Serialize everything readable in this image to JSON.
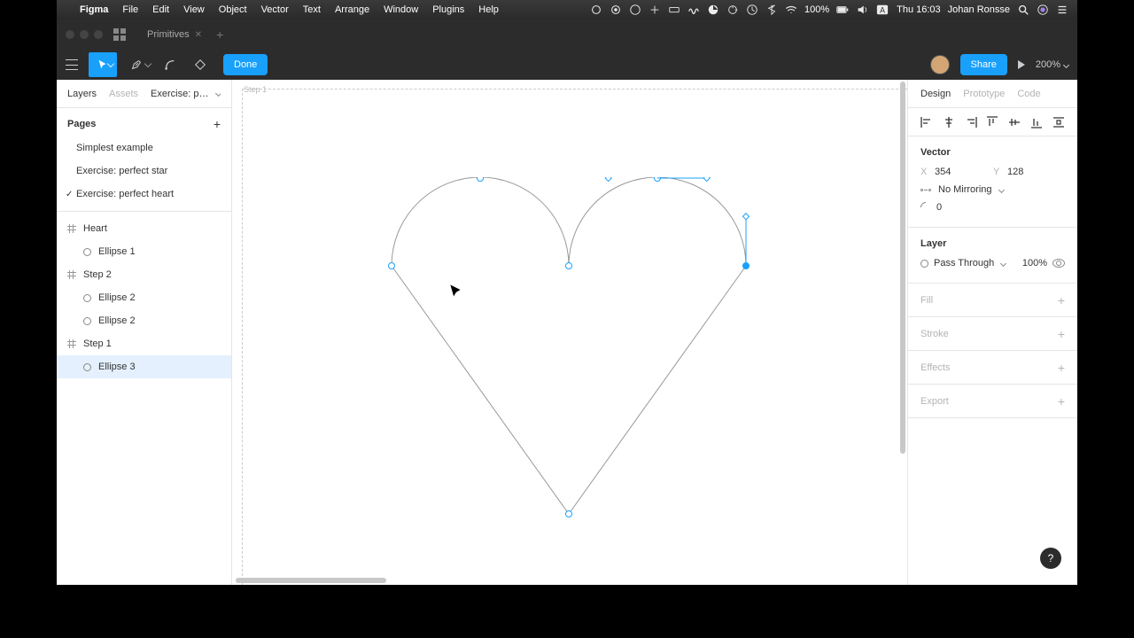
{
  "menubar": {
    "app": "Figma",
    "items": [
      "File",
      "Edit",
      "View",
      "Object",
      "Vector",
      "Text",
      "Arrange",
      "Window",
      "Plugins",
      "Help"
    ],
    "battery": "100%",
    "time": "Thu 16:03",
    "user": "Johan Ronsse"
  },
  "tabbar": {
    "title": "Primitives"
  },
  "toolbar": {
    "done": "Done",
    "share": "Share",
    "zoom": "200%"
  },
  "left": {
    "tabs": {
      "layers": "Layers",
      "assets": "Assets",
      "file": "Exercise: perfect …"
    },
    "pages_header": "Pages",
    "pages": [
      {
        "label": "Simplest example",
        "checked": false
      },
      {
        "label": "Exercise: perfect star",
        "checked": false
      },
      {
        "label": "Exercise: perfect heart",
        "checked": true
      }
    ],
    "layers": [
      {
        "type": "frame",
        "label": "Heart"
      },
      {
        "type": "ellipse",
        "label": "Ellipse 1",
        "indent": true
      },
      {
        "type": "frame",
        "label": "Step 2"
      },
      {
        "type": "ellipse",
        "label": "Ellipse 2",
        "indent": true
      },
      {
        "type": "ellipse",
        "label": "Ellipse 2",
        "indent": true
      },
      {
        "type": "frame",
        "label": "Step 1"
      },
      {
        "type": "ellipse",
        "label": "Ellipse 3",
        "indent": true,
        "selected": true
      }
    ]
  },
  "canvas": {
    "frame_label": "Step 1"
  },
  "right": {
    "tabs": {
      "design": "Design",
      "prototype": "Prototype",
      "code": "Code"
    },
    "vector": {
      "title": "Vector",
      "x_label": "X",
      "x": "354",
      "y_label": "Y",
      "y": "128",
      "mirroring": "No Mirroring",
      "arc": "0"
    },
    "layer": {
      "title": "Layer",
      "blend": "Pass Through",
      "opacity": "100%"
    },
    "sections": {
      "fill": "Fill",
      "stroke": "Stroke",
      "effects": "Effects",
      "export": "Export"
    }
  },
  "help": "?"
}
